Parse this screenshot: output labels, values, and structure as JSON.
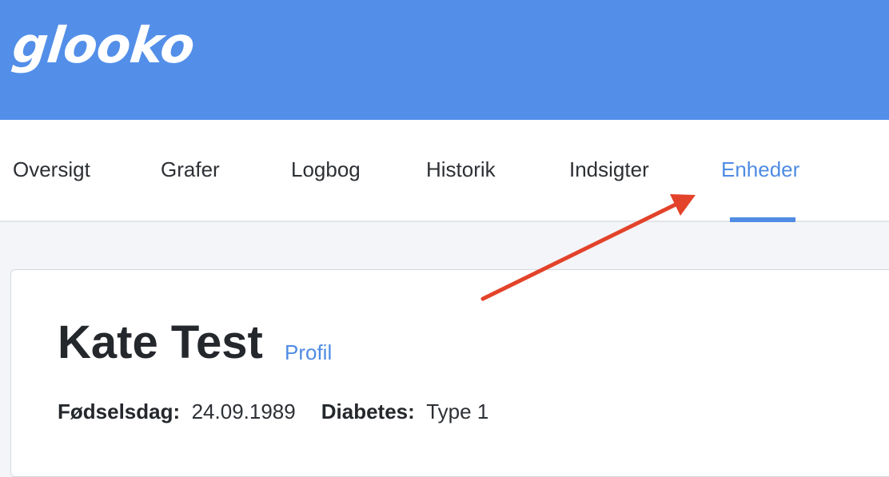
{
  "header": {
    "logo_text": "glooko",
    "background_color": "#538fe9"
  },
  "nav": {
    "tabs": [
      {
        "label": "Oversigt",
        "active": false
      },
      {
        "label": "Grafer",
        "active": false
      },
      {
        "label": "Logbog",
        "active": false
      },
      {
        "label": "Historik",
        "active": false
      },
      {
        "label": "Indsigter",
        "active": false
      },
      {
        "label": "Enheder",
        "active": true
      }
    ],
    "active_color": "#4f8ce3"
  },
  "patient": {
    "name": "Kate Test",
    "profile_link": "Profil",
    "birthday_label": "Fødselsdag:",
    "birthday_value": "24.09.1989",
    "diabetes_label": "Diabetes:",
    "diabetes_value": "Type 1"
  },
  "annotation": {
    "arrow_color": "#e2432a",
    "points_to": "Enheder"
  }
}
